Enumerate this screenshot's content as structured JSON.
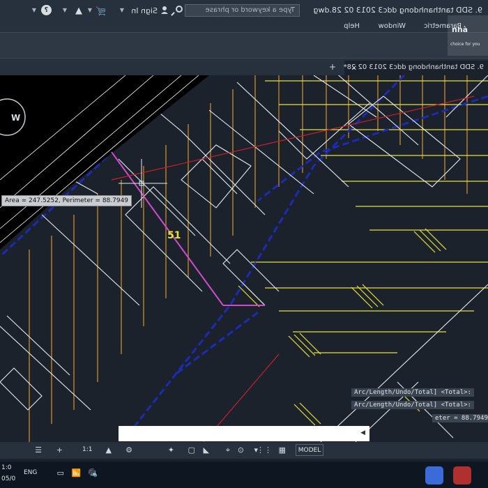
{
  "window": {
    "file_title": "9. SDD tanthanhdong ddc3 2013 02 28.dwg",
    "search_placeholder": "Type a keyword or phrase",
    "sign_in": "Sign In"
  },
  "menu": [
    "Parametric",
    "Window",
    "Help"
  ],
  "logo": {
    "text": "nhà",
    "tagline": "choice for you"
  },
  "tab": {
    "label": "9. SDD tanthanhdong ddc3 2013 02 28*"
  },
  "drawing": {
    "area_tooltip": "Area = 247.5252, Perimeter = 88.7949",
    "plot_number": "51",
    "compass": "W"
  },
  "command": {
    "history": [
      "Arc/Length/Undo/Total] <Total>:",
      "Arc/Length/Undo/Total] <Total>:",
      "eter = 88.7949"
    ]
  },
  "statusbar": {
    "model": "MODEL",
    "scale": "1:1"
  },
  "taskbar": {
    "time": "1:0",
    "date": "05/0",
    "lang": "ENG"
  },
  "colors": {
    "background": "#1b222c",
    "yellow": "#e7e23a",
    "magenta": "#d04ad0",
    "blue": "#1c2bb5",
    "red": "#c8202a",
    "orange": "#c98c2a"
  }
}
